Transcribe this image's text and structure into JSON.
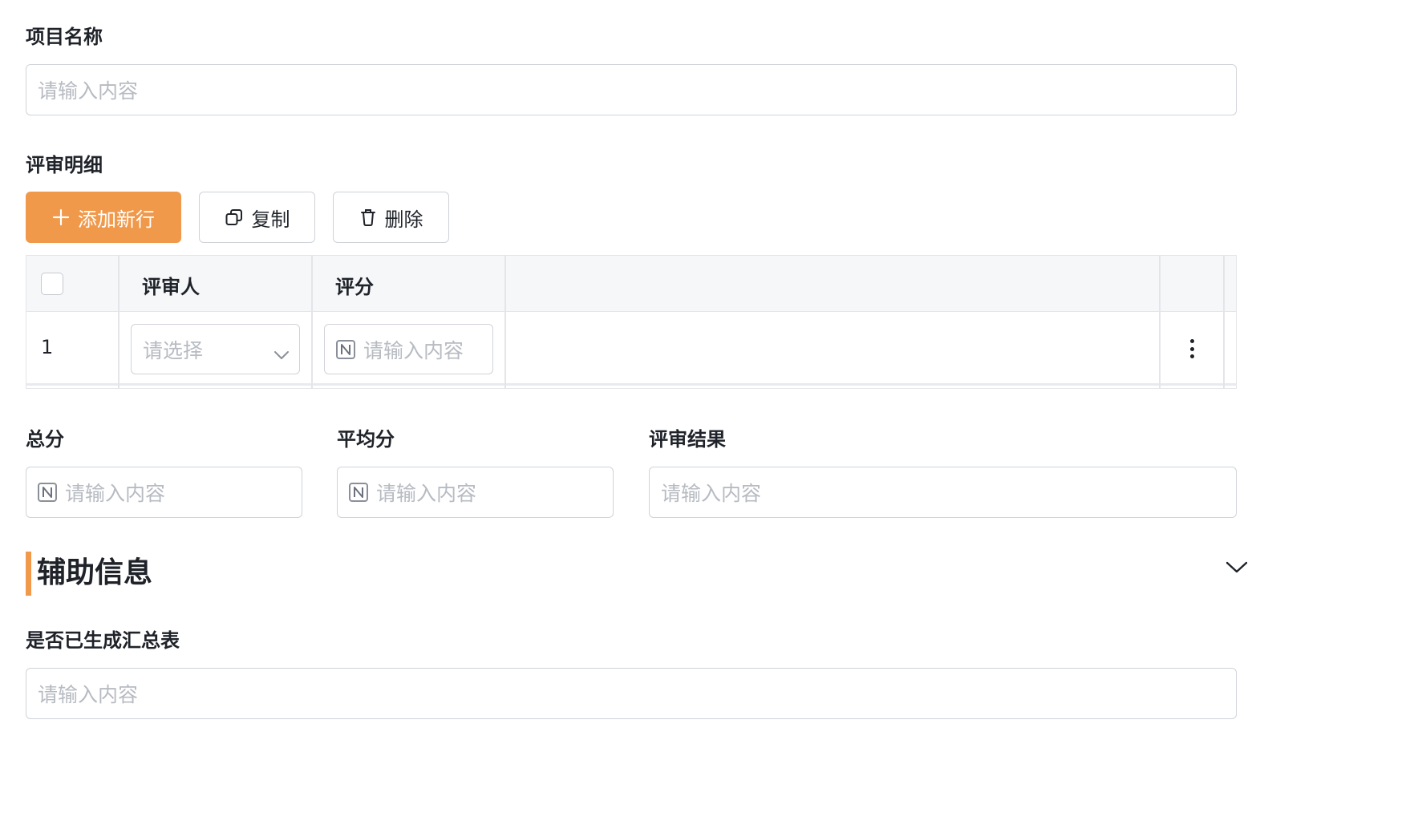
{
  "form": {
    "project_name": {
      "label": "项目名称",
      "placeholder": "请输入内容",
      "value": ""
    },
    "review_details": {
      "label": "评审明细",
      "toolbar": {
        "add_label": "添加新行",
        "copy_label": "复制",
        "delete_label": "删除"
      },
      "columns": [
        "评审人",
        "评分"
      ],
      "rows": [
        {
          "index": "1",
          "reviewer_placeholder": "请选择",
          "score_placeholder": "请输入内容"
        }
      ]
    },
    "total": {
      "label": "总分",
      "placeholder": "请输入内容"
    },
    "average": {
      "label": "平均分",
      "placeholder": "请输入内容"
    },
    "result": {
      "label": "评审结果",
      "placeholder": "请输入内容"
    }
  },
  "aux_section": {
    "title": "辅助信息",
    "expanded": true,
    "summary_generated": {
      "label": "是否已生成汇总表",
      "placeholder": "请输入内容"
    }
  },
  "colors": {
    "accent": "#f0994a",
    "border": "#d0d3d9",
    "placeholder": "#b7bbc2",
    "text": "#1f2329",
    "table_header_bg": "#f6f7f9"
  },
  "icons": {
    "add": "plus-icon",
    "copy": "copy-icon",
    "delete": "trash-icon",
    "number_field": "number-icon",
    "dropdown": "chevron-down-icon",
    "row_menu": "more-vertical-icon",
    "collapse": "chevron-down-icon"
  }
}
